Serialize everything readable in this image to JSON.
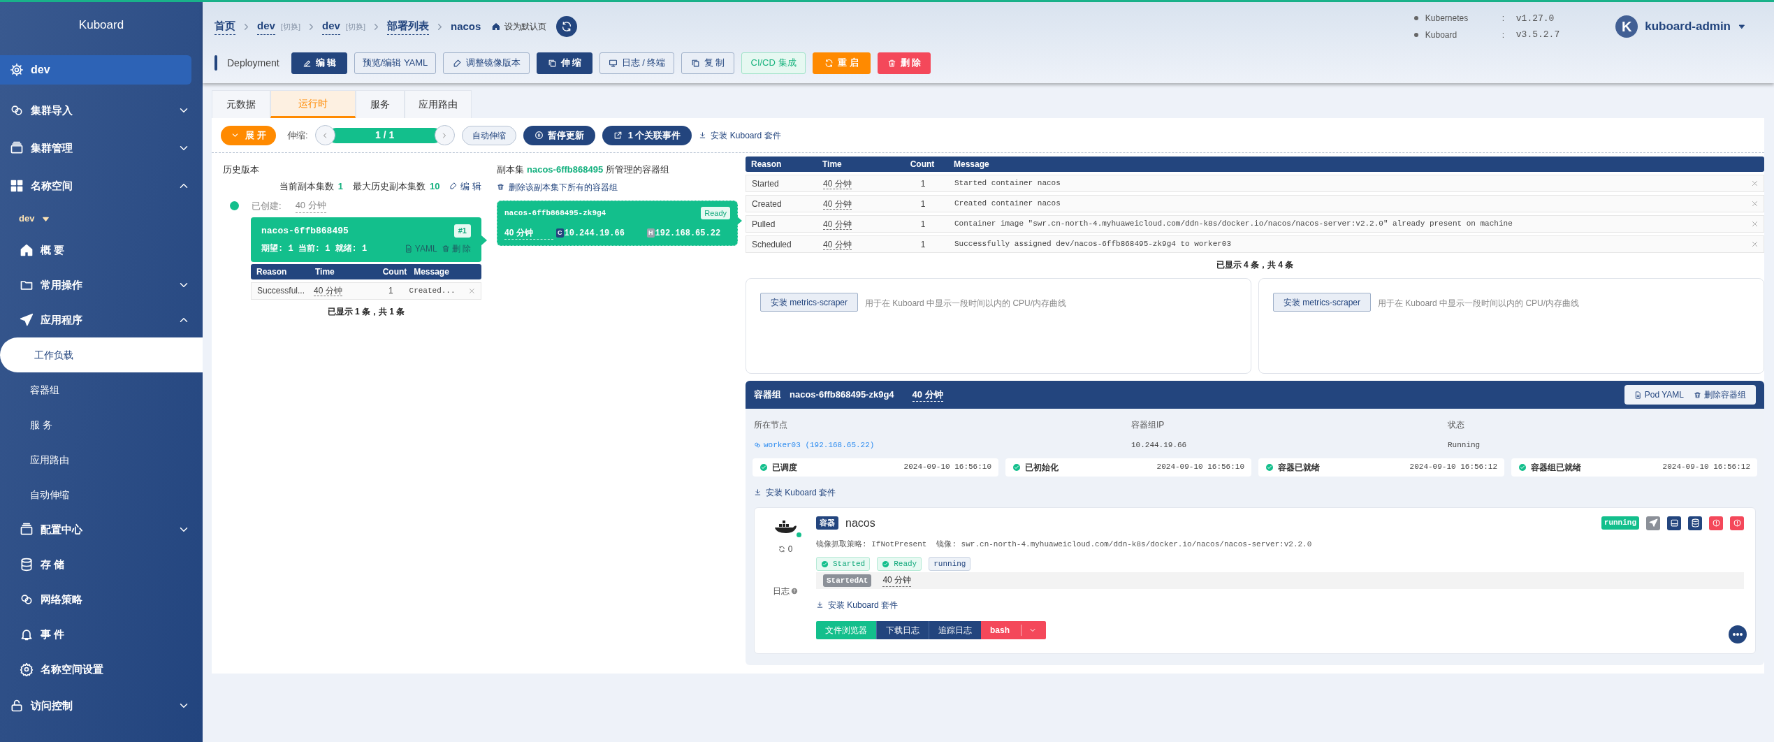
{
  "sidebar": {
    "title": "Kuboard",
    "items": [
      {
        "label": "dev",
        "kind": "cluster",
        "selected": false
      },
      {
        "label": "集群导入",
        "kind": "group",
        "expanded": false,
        "selected": false
      },
      {
        "label": "集群管理",
        "kind": "group",
        "expanded": false,
        "selected": false
      },
      {
        "label": "名称空间",
        "kind": "group",
        "expanded": true,
        "selected": false,
        "children": [
          {
            "label": "dev",
            "kind": "namespace",
            "selected": false
          },
          {
            "label": "概 要",
            "kind": "item",
            "selected": false
          },
          {
            "label": "常用操作",
            "kind": "item",
            "expanded": false,
            "selected": false
          },
          {
            "label": "应用程序",
            "kind": "item",
            "expanded": true,
            "selected": false,
            "children": [
              {
                "label": "工作负载",
                "kind": "leaf",
                "selected": true
              },
              {
                "label": "容器组",
                "kind": "leaf",
                "selected": false
              },
              {
                "label": "服 务",
                "kind": "leaf",
                "selected": false
              },
              {
                "label": "应用路由",
                "kind": "leaf",
                "selected": false
              },
              {
                "label": "自动伸缩",
                "kind": "leaf",
                "selected": false
              }
            ]
          },
          {
            "label": "配置中心",
            "kind": "item",
            "expanded": false,
            "selected": false
          },
          {
            "label": "存 储",
            "kind": "item",
            "selected": false
          },
          {
            "label": "网络策略",
            "kind": "item",
            "selected": false
          },
          {
            "label": "事 件",
            "kind": "item",
            "selected": false
          },
          {
            "label": "名称空间设置",
            "kind": "item",
            "selected": false
          }
        ]
      },
      {
        "label": "访问控制",
        "kind": "group",
        "expanded": false,
        "selected": false
      }
    ]
  },
  "breadcrumb": [
    {
      "label": "首页",
      "kind": "link"
    },
    {
      "label": "dev",
      "kind": "link",
      "switch": "[切换]"
    },
    {
      "label": "dev",
      "kind": "link",
      "switch": "[切换]"
    },
    {
      "label": "部署列表",
      "kind": "link"
    },
    {
      "label": "nacos",
      "kind": "current"
    }
  ],
  "set_default": "设为默认页",
  "versions": [
    {
      "name": "Kubernetes",
      "separator": ":",
      "value": "v1.27.0"
    },
    {
      "name": "Kuboard",
      "separator": ":",
      "value": "v3.5.2.7"
    }
  ],
  "user": {
    "avatar": "K",
    "name": "kuboard-admin"
  },
  "resource_kind": "Deployment",
  "actions": [
    {
      "label": "编 辑",
      "kind": "primary"
    },
    {
      "label": "预览/编辑 YAML",
      "kind": "outline"
    },
    {
      "label": "调整镜像版本",
      "kind": "outline"
    },
    {
      "label": "伸 缩",
      "kind": "primary"
    },
    {
      "label": "日志 / 终端",
      "kind": "outline"
    },
    {
      "label": "复 制",
      "kind": "outline"
    },
    {
      "label": "CI/CD 集成",
      "kind": "green"
    },
    {
      "label": "重 启",
      "kind": "orange"
    },
    {
      "label": "删 除",
      "kind": "red"
    }
  ],
  "tabs": [
    {
      "label": "元数据",
      "selected": false
    },
    {
      "label": "运行时",
      "selected": true
    },
    {
      "label": "服务",
      "selected": false
    },
    {
      "label": "应用路由",
      "selected": false
    }
  ],
  "toolbar": {
    "expand": "展 开",
    "scale_label": "伸缩:",
    "scale_value": "1 / 1",
    "auto_scale": "自动伸缩",
    "pause": "暂停更新",
    "events": "1 个关联事件",
    "install": "安装 Kuboard 套件"
  },
  "history": {
    "title": "历史版本",
    "current_label": "当前副本集数",
    "current_value": "1",
    "max_label": "最大历史副本集数",
    "max_value": "10",
    "edit": "编 辑",
    "created_label": "已创建:",
    "created_value": "40 分钟",
    "card": {
      "name": "nacos-6ffb868495",
      "badge": "#1",
      "status": "期望: 1 当前: 1 就绪: 1",
      "yaml": "YAML",
      "delete": "删 除"
    },
    "columns": [
      "Reason",
      "Time",
      "Count",
      "Message"
    ],
    "rows": [
      [
        "Successful...",
        "40 分钟",
        "1",
        "Created..."
      ]
    ],
    "footer": "已显示 1 条，共 1 条"
  },
  "replicaset": {
    "title_prefix": "副本集",
    "name": "nacos-6ffb868495",
    "title_suffix": "所管理的容器组",
    "delete_all": "删除该副本集下所有的容器组",
    "pod": {
      "name": "nacos-6ffb868495-zk9g4",
      "status": "Ready",
      "age": "40 分钟",
      "ips": [
        {
          "tag": "C",
          "value": "10.244.19.66"
        },
        {
          "tag": "H",
          "value": "192.168.65.22"
        }
      ]
    }
  },
  "events": {
    "columns": [
      "Reason",
      "Time",
      "Count",
      "Message"
    ],
    "rows": [
      [
        "Started",
        "40 分钟",
        "1",
        "Started container nacos"
      ],
      [
        "Created",
        "40 分钟",
        "1",
        "Created container nacos"
      ],
      [
        "Pulled",
        "40 分钟",
        "1",
        "Container image \"swr.cn-north-4.myhuaweicloud.com/ddn-k8s/docker.io/nacos/nacos-server:v2.2.0\" already present on machine"
      ],
      [
        "Scheduled",
        "40 分钟",
        "1",
        "Successfully assigned dev/nacos-6ffb868495-zk9g4 to worker03"
      ]
    ],
    "footer": "已显示 4 条，共 4 条"
  },
  "metrics": [
    {
      "button": "安装 metrics-scraper",
      "text": "用于在 Kuboard 中显示一段时间以内的 CPU/内存曲线"
    },
    {
      "button": "安装 metrics-scraper",
      "text": "用于在 Kuboard 中显示一段时间以内的 CPU/内存曲线"
    }
  ],
  "pod": {
    "label": "容器组",
    "name": "nacos-6ffb868495-zk9g4",
    "age": "40 分钟",
    "yaml": "Pod YAML",
    "delete": "删除容器组",
    "info": [
      {
        "label": "所在节点",
        "value": "worker03 (192.168.65.22)",
        "kind": "link"
      },
      {
        "label": "容器组IP",
        "value": "10.244.19.66",
        "kind": "text"
      },
      {
        "label": "状态",
        "value": "Running",
        "kind": "text"
      }
    ],
    "conditions": [
      {
        "label": "已调度",
        "time": "2024-09-10 16:56:10"
      },
      {
        "label": "已初始化",
        "time": "2024-09-10 16:56:10"
      },
      {
        "label": "容器已就绪",
        "time": "2024-09-10 16:56:12"
      },
      {
        "label": "容器组已就绪",
        "time": "2024-09-10 16:56:12"
      }
    ],
    "install": "安装 Kuboard 套件",
    "container": {
      "tag": "容器",
      "name": "nacos",
      "restarts": "0",
      "log_label": "日志",
      "pull_policy": "镜像抓取策略: IfNotPresent",
      "image": "镜像: swr.cn-north-4.myhuaweicloud.com/ddn-k8s/docker.io/nacos/nacos-server:v2.2.0",
      "state": "running",
      "tags": [
        {
          "label": "Started",
          "kind": "ok"
        },
        {
          "label": "Ready",
          "kind": "ok"
        },
        {
          "label": "running",
          "kind": "plain"
        }
      ],
      "started_label": "StartedAt",
      "started_value": "40 分钟",
      "install": "安装 Kuboard 套件",
      "buttons": [
        {
          "label": "文件浏览器",
          "kind": "green"
        },
        {
          "label": "下载日志",
          "kind": "primary"
        },
        {
          "label": "追踪日志",
          "kind": "primary"
        },
        {
          "label": "bash",
          "kind": "red"
        }
      ]
    }
  }
}
